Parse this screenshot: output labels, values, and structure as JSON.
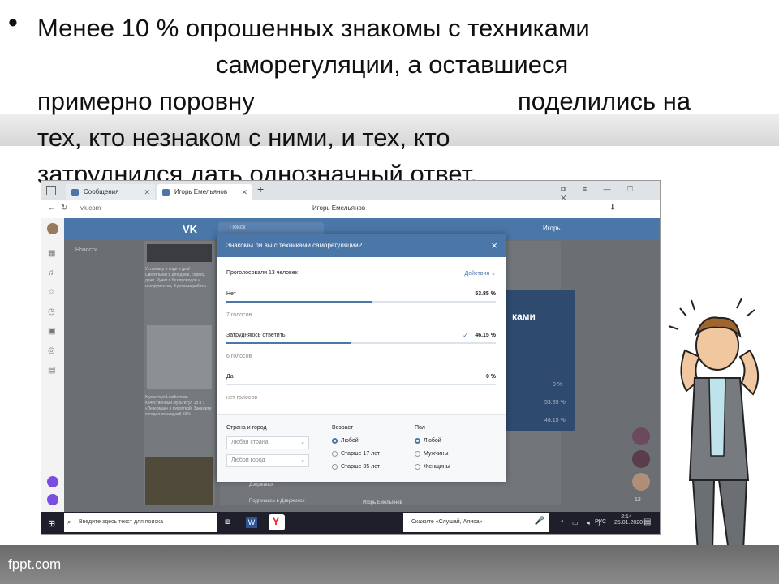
{
  "slide": {
    "bullet": "•",
    "lines": [
      "Менее 10 % опрошенных знакомы с техниками",
      "саморегуляции, а оставшиеся",
      "примерно поровну",
      "поделились на",
      "тех, кто незнаком с ними, и тех, кто",
      "затруднился дать однозначный ответ."
    ],
    "footer": "fppt.com"
  },
  "browser": {
    "tabs": [
      {
        "label": "Сообщения"
      },
      {
        "label": "Игорь Емельянов"
      }
    ],
    "new_tab": "+",
    "url": "vk.com",
    "page_title": "Игорь Емельянов"
  },
  "vk": {
    "search_placeholder": "Поиск",
    "user_name": "Игорь",
    "news_label": "Новости",
    "card1_text": "Установку в ходе в дом! Светильник в для дома, сервиз, дачи. Ручки в без проводов и инструментов, 3 режима работы",
    "card2_text": "Мультитул Leatherman Качественный мультитул 18 в 1 «Лезерман» в рукояткой. Закажите сегодня со скидкой 50%",
    "right_panel_title": "ками",
    "right_rows": [
      "0 %",
      "53.85 %",
      "46.15 %"
    ],
    "right_counter": "12",
    "bottom_left": "Дзержинск",
    "bottom_left2": "Подпишись в Дзержинск",
    "bottom_center": "Игорь Емельянов"
  },
  "modal": {
    "title": "Знакомы ли вы с техниками саморегуляции?",
    "close": "×",
    "voted": "Проголосовали 13 человек",
    "actions": "Действия ⌄",
    "options": [
      {
        "label": "Нет",
        "percent": "53.85 %",
        "votes": "7 голосов",
        "fraction": 0.5385,
        "checked": false
      },
      {
        "label": "Затрудняюсь ответить",
        "percent": "46.15 %",
        "votes": "6 голосов",
        "fraction": 0.4615,
        "checked": true
      },
      {
        "label": "Да",
        "percent": "0 %",
        "votes": "нет голосов",
        "fraction": 0,
        "checked": false
      }
    ],
    "filters": {
      "country_label": "Страна и город",
      "country_placeholder": "Любая страна",
      "city_placeholder": "Любой город",
      "age_label": "Возраст",
      "age_options": [
        "Любой",
        "Старше 17 лет",
        "Старше 35 лет"
      ],
      "sex_label": "Пол",
      "sex_options": [
        "Любой",
        "Мужчины",
        "Женщины"
      ]
    }
  },
  "taskbar": {
    "search_placeholder": "Введите здесь текст для поиска",
    "alice": "Скажите «Слушай, Алиса»",
    "lang": "РУС",
    "time": "2:14",
    "date": "25.01.2020"
  },
  "colors": {
    "vk_blue": "#4a76a8",
    "taskbar": "#1f1f2b"
  }
}
